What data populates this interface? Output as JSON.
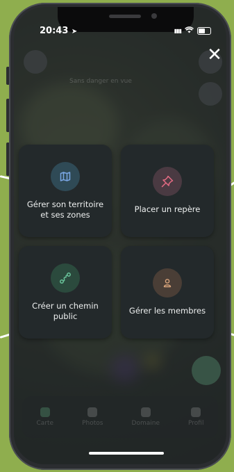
{
  "status_bar": {
    "time": "20:43",
    "signal": "▮▮▮",
    "wifi": "wifi-icon"
  },
  "close": {
    "label": "✕"
  },
  "menu": {
    "items": [
      {
        "label": "Gérer son territoire\net ses zones",
        "icon": "map-icon",
        "color": "#79a6e3",
        "bg": "#2f4a56"
      },
      {
        "label": "Placer un repère",
        "icon": "pin-icon",
        "color": "#e46b83",
        "bg": "#4a3a42"
      },
      {
        "label": "Créer un chemin\npublic",
        "icon": "path-icon",
        "color": "#69c39a",
        "bg": "#2b4a3d"
      },
      {
        "label": "Gérer les membres",
        "icon": "person-icon",
        "color": "#d9a47b",
        "bg": "#4a3e36"
      }
    ]
  },
  "background_header": "Sans danger en vue",
  "bottom_nav": {
    "items": [
      {
        "label": "Carte"
      },
      {
        "label": "Photos"
      },
      {
        "label": "Domaine"
      },
      {
        "label": "Profil"
      }
    ]
  },
  "colors": {
    "frame_bg": "#8fae4e",
    "card_bg": "#23292b"
  }
}
